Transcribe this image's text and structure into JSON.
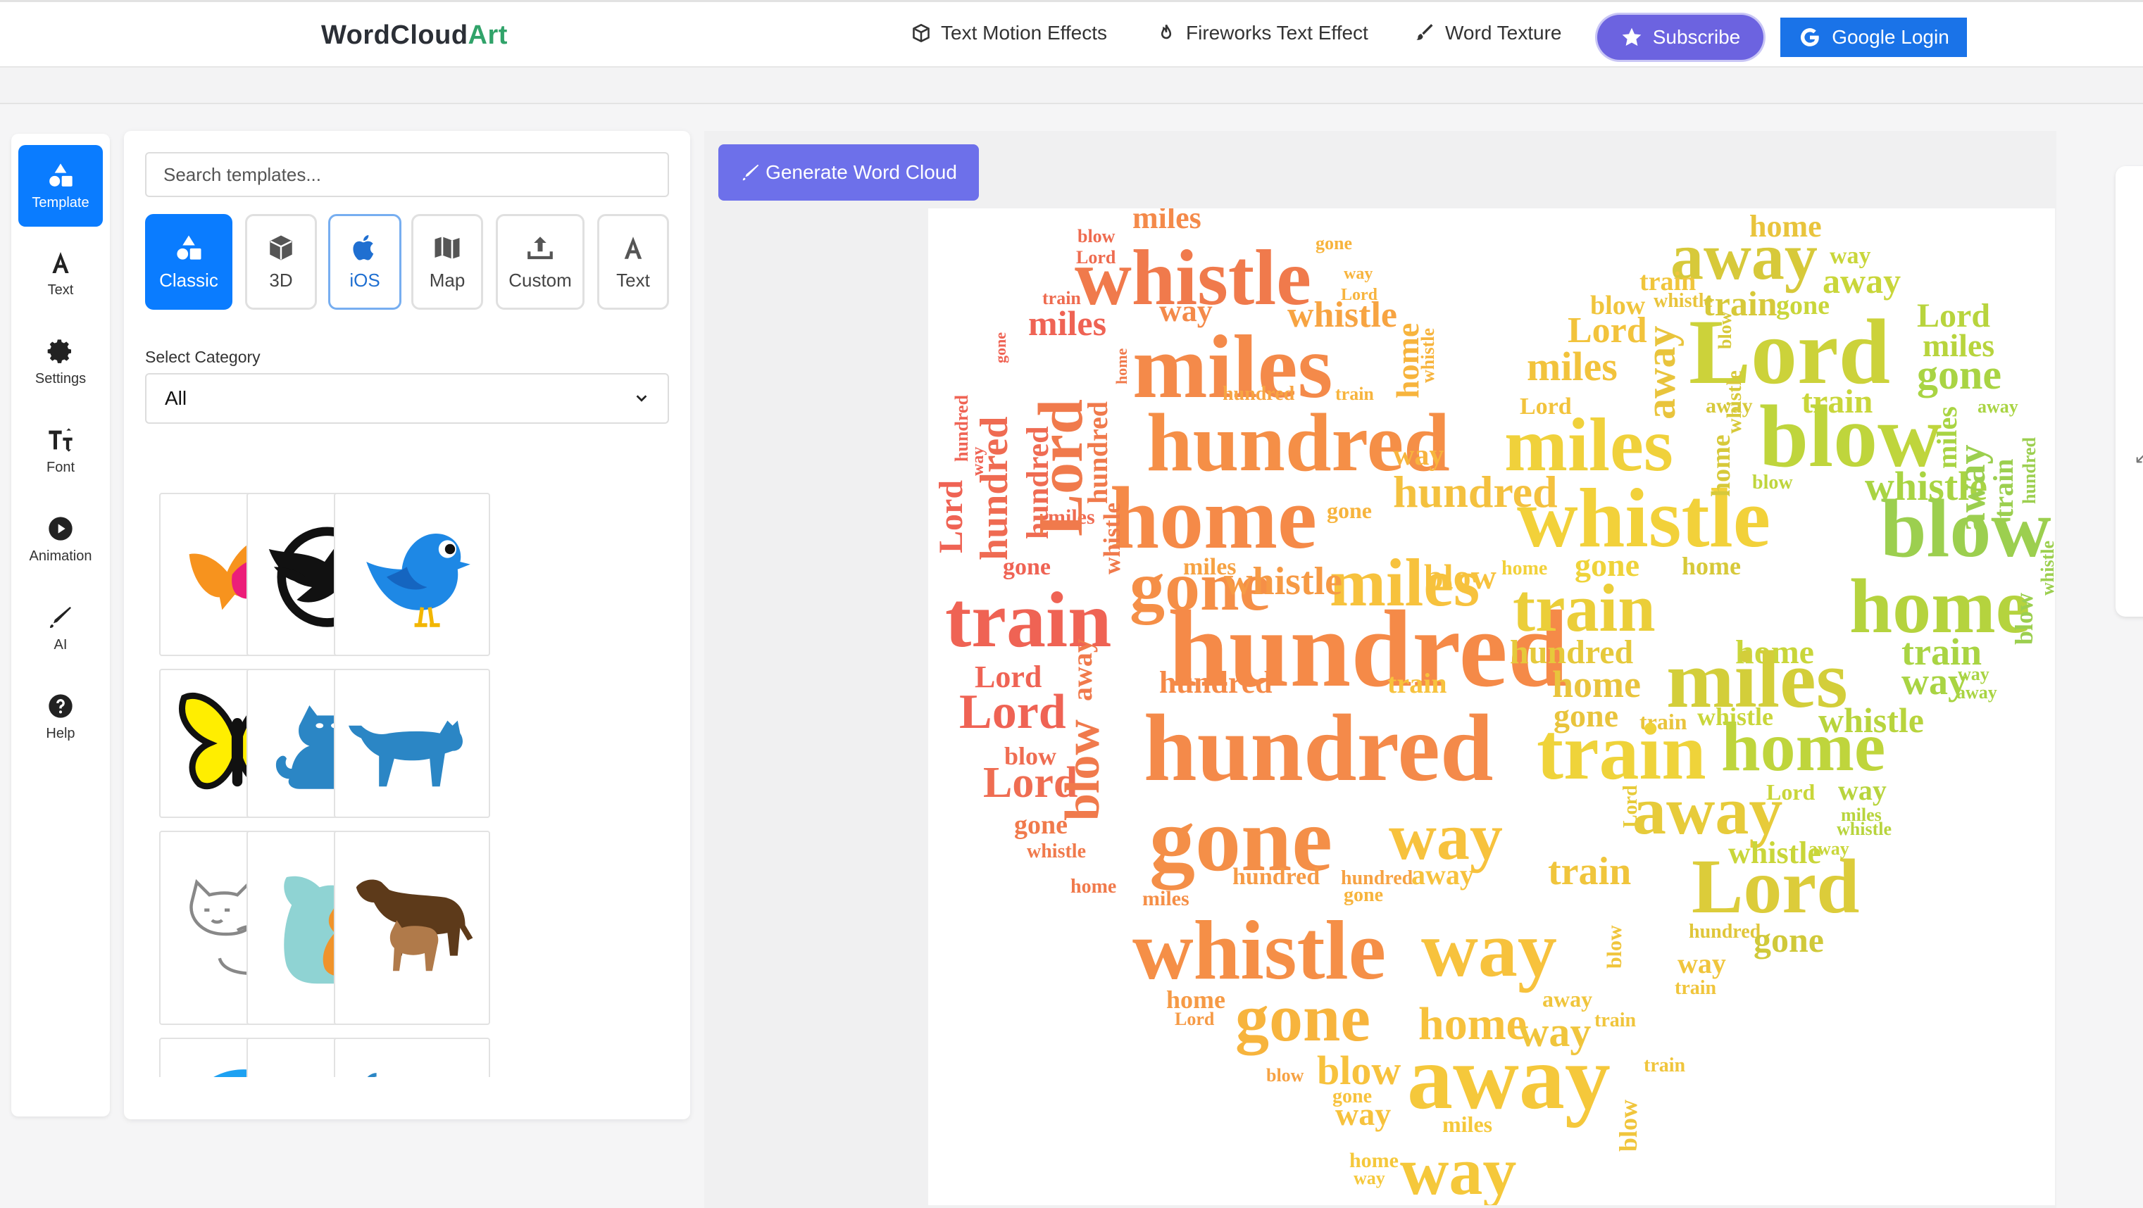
{
  "brand": {
    "name_main": "WordCloud",
    "name_accent": "Art"
  },
  "nav": {
    "links": [
      {
        "label": "Text Motion Effects",
        "icon": "cube-icon"
      },
      {
        "label": "Fireworks Text Effect",
        "icon": "fire-icon"
      },
      {
        "label": "Word Texture",
        "icon": "brush-icon"
      }
    ],
    "subscribe_label": "Subscribe",
    "google_login_label": "Google Login"
  },
  "sidebar": {
    "items": [
      {
        "label": "Template",
        "icon": "shapes-icon",
        "active": true
      },
      {
        "label": "Text",
        "icon": "text-icon"
      },
      {
        "label": "Settings",
        "icon": "gear-icon"
      },
      {
        "label": "Font",
        "icon": "font-size-icon"
      },
      {
        "label": "Animation",
        "icon": "play-icon"
      },
      {
        "label": "AI",
        "icon": "pen-icon"
      },
      {
        "label": "Help",
        "icon": "question-icon"
      }
    ]
  },
  "templates": {
    "search_placeholder": "Search templates...",
    "tabs": [
      {
        "label": "Classic",
        "icon": "shapes-icon",
        "selected": true
      },
      {
        "label": "3D",
        "icon": "cube-icon"
      },
      {
        "label": "iOS",
        "icon": "apple-icon"
      },
      {
        "label": "Map",
        "icon": "map-icon"
      },
      {
        "label": "Custom",
        "icon": "upload-icon"
      },
      {
        "label": "Text",
        "icon": "text-icon"
      }
    ],
    "category_label": "Select Category",
    "category_value": "All",
    "items": [
      "bird-color",
      "eagle-emblem",
      "blue-bird",
      "butterfly",
      "cat-sitting",
      "cat-walking",
      "cat-outline",
      "dog-and-cat",
      "dogs",
      "twitter-bird",
      "cat-partial",
      "dog-partial"
    ]
  },
  "editor": {
    "generate_label": "Generate Word Cloud"
  },
  "wordcloud": {
    "colors": {
      "red": "#ef6354",
      "orange": "#f89145",
      "yellow": "#f3cc3b",
      "lime": "#c9d63a",
      "green": "#9ccf4f"
    },
    "words": [
      "miles",
      "whistle",
      "Lord",
      "hundred",
      "home",
      "gone",
      "train",
      "blow",
      "away",
      "way"
    ]
  }
}
